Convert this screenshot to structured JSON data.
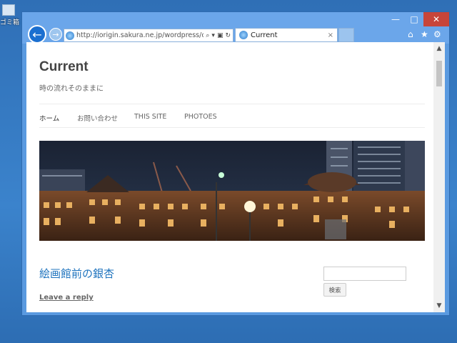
{
  "desktop": {
    "icon_label": "ゴミ箱"
  },
  "window": {
    "controls": {
      "minimize": "—",
      "maximize": "□",
      "close": "✕"
    },
    "nav": {
      "back_icon": "←",
      "forward_icon": "→"
    },
    "address": {
      "url": "http://iorigin.sakura.ne.jp/wordpress/cu",
      "tools": [
        "⌕",
        "▾",
        "▣",
        "↻"
      ]
    },
    "tab": {
      "title": "Current",
      "close": "×"
    },
    "toolbar_icons": {
      "home": "⌂",
      "favorites": "★",
      "tools": "⚙"
    },
    "scrollbar": {
      "up": "▲",
      "down": "▼"
    }
  },
  "site": {
    "title": "Current",
    "description": "時の流れそのままに",
    "nav": [
      "ホーム",
      "お問い合わせ",
      "THIS SITE",
      "PHOTOES"
    ]
  },
  "post": {
    "title": "絵画館前の銀杏",
    "reply": "Leave a reply"
  },
  "sidebar": {
    "search_button": "検索",
    "search_value": ""
  },
  "colors": {
    "link": "#1e73be",
    "window_frame": "#6ba6ea",
    "close_button": "#c7453a"
  }
}
